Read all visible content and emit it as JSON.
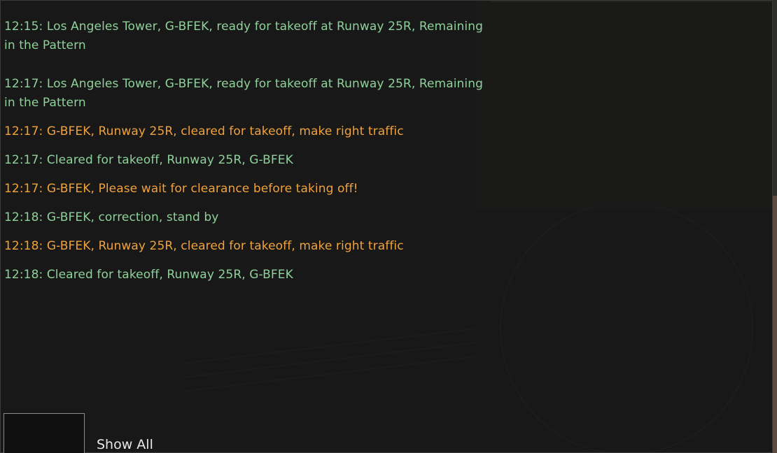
{
  "messages": [
    {
      "text": "12:15: Los Angeles Tower, G-BFEK, ready for takeoff at Runway 25R, Remaining in the Pattern",
      "speaker": "pilot"
    },
    {
      "text": "12:17: Los Angeles Tower, G-BFEK, ready for takeoff at Runway 25R, Remaining in the Pattern",
      "speaker": "pilot"
    },
    {
      "text": "12:17: G-BFEK, Runway 25R, cleared for takeoff, make right traffic",
      "speaker": "atc"
    },
    {
      "text": "12:17: Cleared for takeoff, Runway 25R, G-BFEK",
      "speaker": "pilot"
    },
    {
      "text": "12:17: G-BFEK, Please wait for clearance before taking off!",
      "speaker": "atc"
    },
    {
      "text": "12:18: G-BFEK, correction, stand by",
      "speaker": "pilot"
    },
    {
      "text": "12:18: G-BFEK, Runway 25R, cleared for takeoff, make right traffic",
      "speaker": "atc"
    },
    {
      "text": "12:18: Cleared for takeoff, Runway 25R, G-BFEK",
      "speaker": "pilot"
    }
  ],
  "show_all": {
    "label": "Show All",
    "checked": false
  },
  "colors": {
    "pilot": "#8fd19a",
    "atc": "#f0a23c"
  }
}
